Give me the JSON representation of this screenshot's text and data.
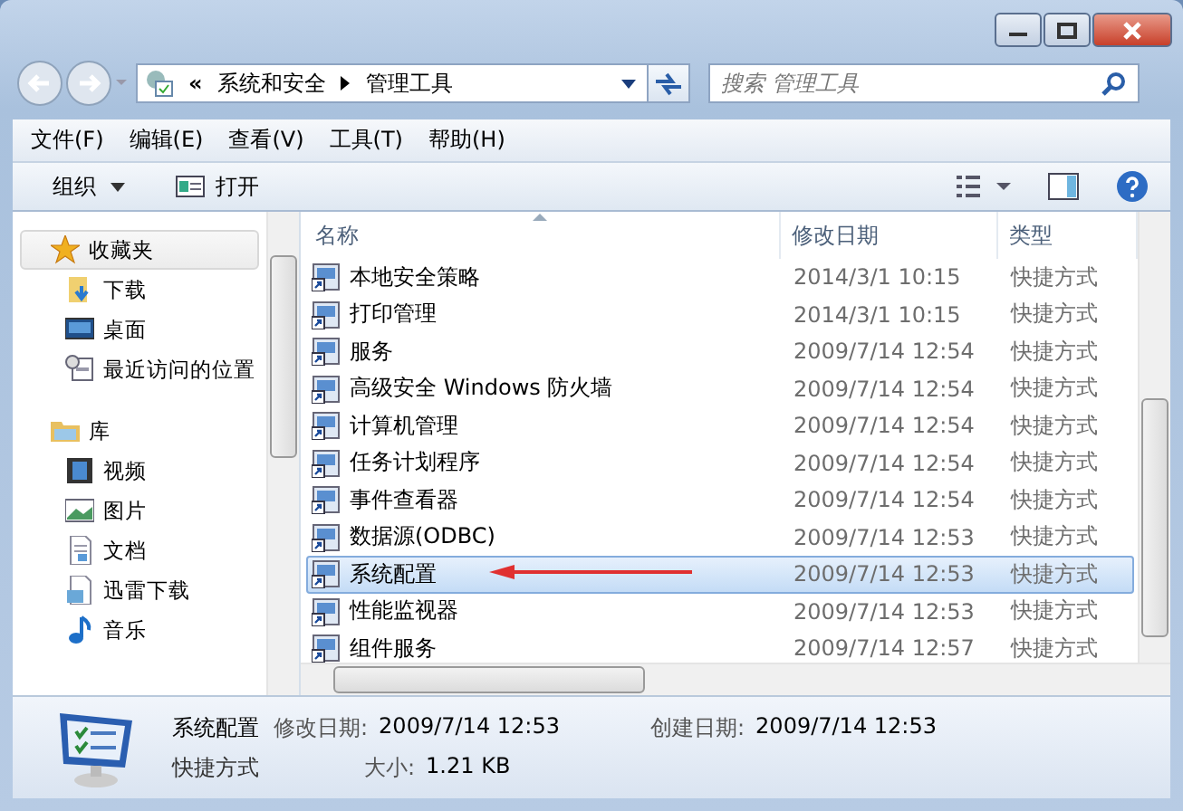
{
  "address": {
    "prefix": "«",
    "crumbs": [
      "系统和安全",
      "管理工具"
    ]
  },
  "search": {
    "placeholder": "搜索 管理工具"
  },
  "menu": [
    "文件(F)",
    "编辑(E)",
    "查看(V)",
    "工具(T)",
    "帮助(H)"
  ],
  "toolbar": {
    "buttons": [
      "组织",
      "打开"
    ]
  },
  "nav": [
    {
      "label": "收藏夹",
      "selected": true,
      "children": [
        {
          "label": "下载",
          "selected": false
        },
        {
          "label": "桌面",
          "selected": false
        },
        {
          "label": "最近访问的位置",
          "selected": false
        }
      ]
    },
    {
      "label": "库",
      "selected": false,
      "children": [
        {
          "label": "视频",
          "selected": false
        },
        {
          "label": "图片",
          "selected": false
        },
        {
          "label": "文档",
          "selected": false
        },
        {
          "label": "迅雷下载",
          "selected": false
        },
        {
          "label": "音乐",
          "selected": false
        }
      ]
    }
  ],
  "table": {
    "columns": [
      "名称",
      "修改日期",
      "类型"
    ],
    "rows": [
      {
        "name": "本地安全策略",
        "date": "2014/3/1 10:15",
        "type": "快捷方式",
        "selected": false
      },
      {
        "name": "打印管理",
        "date": "2014/3/1 10:15",
        "type": "快捷方式",
        "selected": false
      },
      {
        "name": "服务",
        "date": "2009/7/14 12:54",
        "type": "快捷方式",
        "selected": false
      },
      {
        "name": "高级安全 Windows 防火墙",
        "date": "2009/7/14 12:54",
        "type": "快捷方式",
        "selected": false
      },
      {
        "name": "计算机管理",
        "date": "2009/7/14 12:54",
        "type": "快捷方式",
        "selected": false
      },
      {
        "name": "任务计划程序",
        "date": "2009/7/14 12:54",
        "type": "快捷方式",
        "selected": false
      },
      {
        "name": "事件查看器",
        "date": "2009/7/14 12:54",
        "type": "快捷方式",
        "selected": false
      },
      {
        "name": "数据源(ODBC)",
        "date": "2009/7/14 12:53",
        "type": "快捷方式",
        "selected": false
      },
      {
        "name": "系统配置",
        "date": "2009/7/14 12:53",
        "type": "快捷方式",
        "selected": true
      },
      {
        "name": "性能监视器",
        "date": "2009/7/14 12:53",
        "type": "快捷方式",
        "selected": false
      },
      {
        "name": "组件服务",
        "date": "2009/7/14 12:57",
        "type": "快捷方式",
        "selected": false
      }
    ]
  },
  "details": {
    "name": "系统配置",
    "type": "快捷方式",
    "fields": [
      {
        "label": "修改日期:",
        "value": "2009/7/14 12:53"
      },
      {
        "label": "创建日期:",
        "value": "2009/7/14 12:53"
      },
      {
        "label": "大小:",
        "value": "1.21 KB"
      }
    ]
  }
}
